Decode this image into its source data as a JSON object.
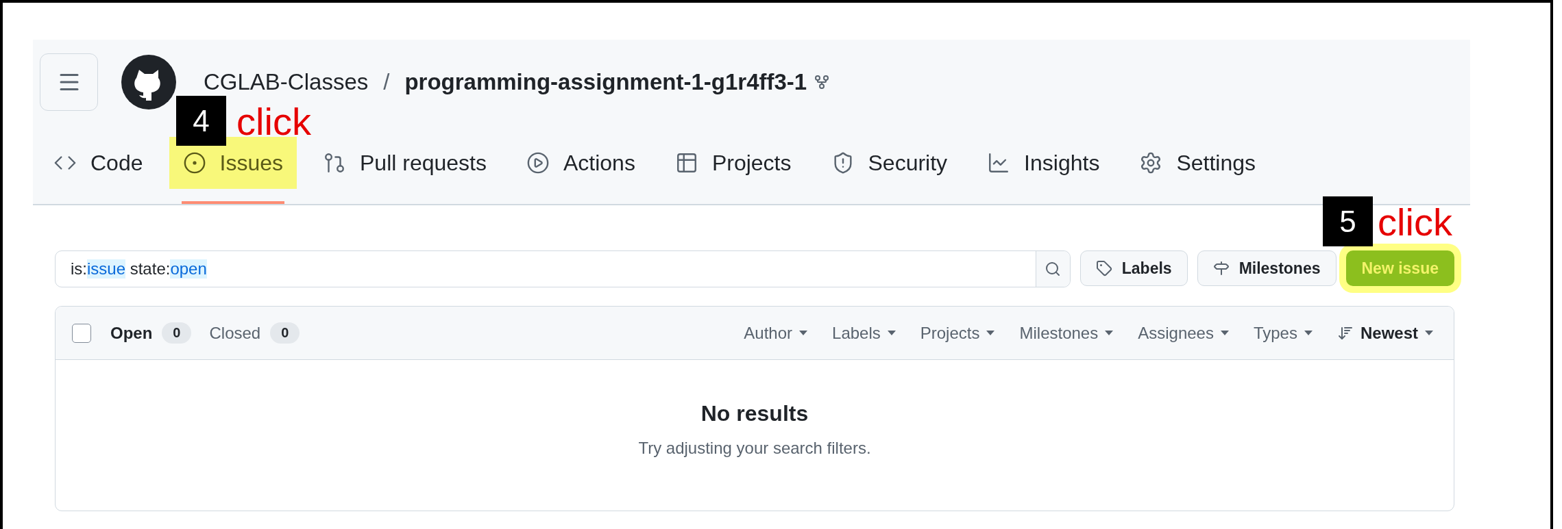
{
  "repo": {
    "owner": "CGLAB-Classes",
    "separator": "/",
    "name": "programming-assignment-1-g1r4ff3-1"
  },
  "tabs": [
    {
      "label": "Code",
      "selected": false,
      "highlighted": false
    },
    {
      "label": "Issues",
      "selected": true,
      "highlighted": true
    },
    {
      "label": "Pull requests",
      "selected": false,
      "highlighted": false
    },
    {
      "label": "Actions",
      "selected": false,
      "highlighted": false
    },
    {
      "label": "Projects",
      "selected": false,
      "highlighted": false
    },
    {
      "label": "Security",
      "selected": false,
      "highlighted": false
    },
    {
      "label": "Insights",
      "selected": false,
      "highlighted": false
    },
    {
      "label": "Settings",
      "selected": false,
      "highlighted": false
    }
  ],
  "search": {
    "query": [
      {
        "text": "is:",
        "kind": "plain"
      },
      {
        "text": "issue",
        "kind": "token"
      },
      {
        "text": " state:",
        "kind": "plain"
      },
      {
        "text": "open",
        "kind": "token"
      }
    ]
  },
  "buttons": [
    {
      "label": "Labels",
      "kind": "secondary",
      "highlighted": false
    },
    {
      "label": "Milestones",
      "kind": "secondary",
      "highlighted": false
    },
    {
      "label": "New issue",
      "kind": "primary",
      "highlighted": true
    }
  ],
  "issue_list": {
    "select_all_checked": false,
    "states": [
      {
        "label": "Open",
        "count": "0",
        "selected": true
      },
      {
        "label": "Closed",
        "count": "0",
        "selected": false
      }
    ],
    "filters": [
      {
        "label": "Author",
        "kind": "filter"
      },
      {
        "label": "Labels",
        "kind": "filter"
      },
      {
        "label": "Projects",
        "kind": "filter"
      },
      {
        "label": "Milestones",
        "kind": "filter"
      },
      {
        "label": "Assignees",
        "kind": "filter"
      },
      {
        "label": "Types",
        "kind": "filter"
      },
      {
        "label": "Newest",
        "kind": "sort"
      }
    ],
    "empty": {
      "title": "No results",
      "hint": "Try adjusting your search filters."
    }
  },
  "annotations": [
    {
      "number": "4",
      "label": "click"
    },
    {
      "number": "5",
      "label": "click"
    }
  ]
}
